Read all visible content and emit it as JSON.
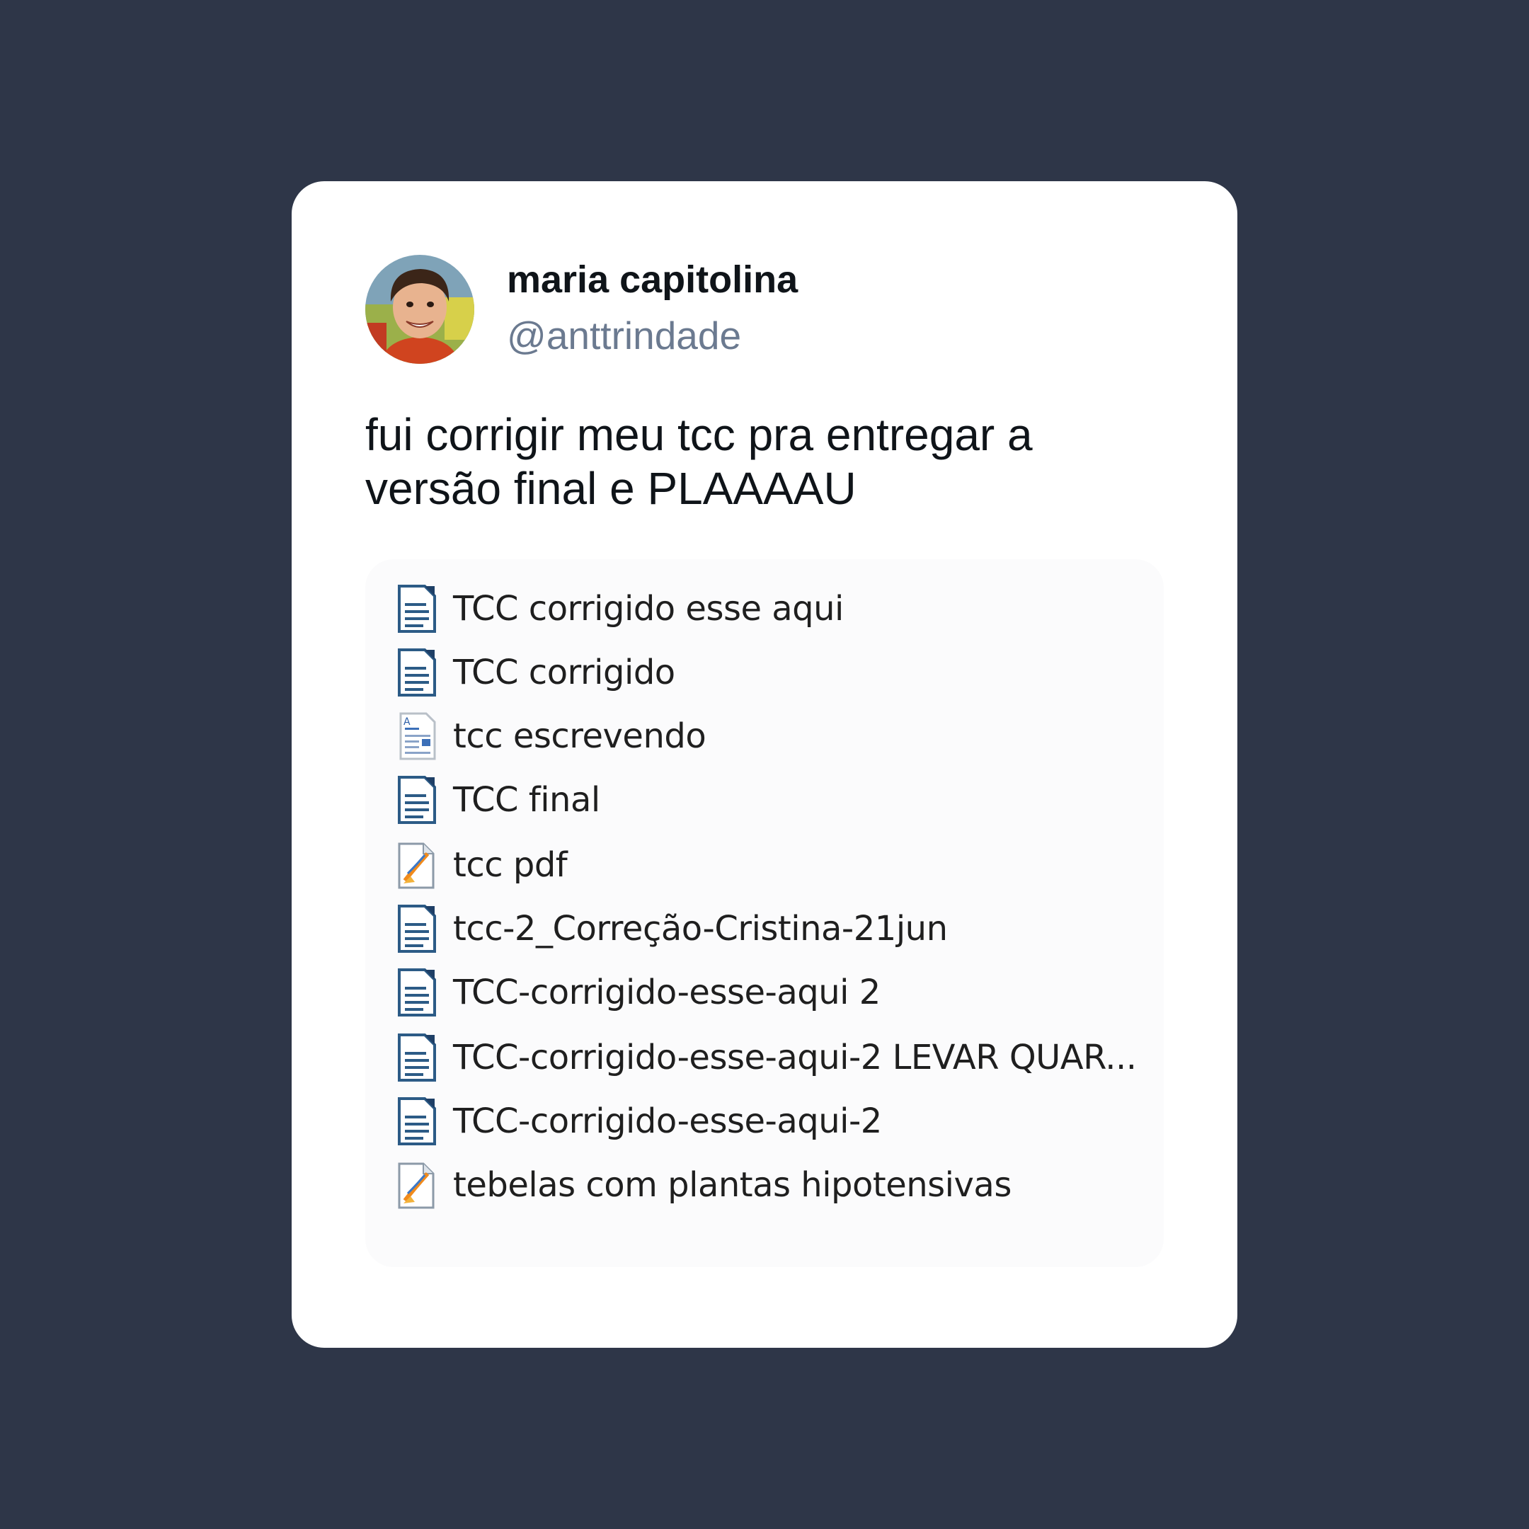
{
  "tweet": {
    "author_name": "maria capitolina",
    "author_handle": "@anttrindade",
    "text": "fui corrigir meu tcc pra entregar a versão final e PLAAAAU",
    "avatar_icon": "profile-photo"
  },
  "attachment": {
    "files": [
      {
        "name": "TCC corrigido esse aqui",
        "icon": "writer-document-icon"
      },
      {
        "name": "TCC corrigido",
        "icon": "writer-document-icon"
      },
      {
        "name": "tcc escrevendo",
        "icon": "word-document-icon"
      },
      {
        "name": "TCC final",
        "icon": "writer-document-icon"
      },
      {
        "name": "tcc pdf",
        "icon": "pdf-document-icon"
      },
      {
        "name": "tcc-2_Correção-Cristina-21jun",
        "icon": "writer-document-icon"
      },
      {
        "name": "TCC-corrigido-esse-aqui 2",
        "icon": "writer-document-icon"
      },
      {
        "name": "TCC-corrigido-esse-aqui-2 LEVAR QUAR...",
        "icon": "writer-document-icon"
      },
      {
        "name": "TCC-corrigido-esse-aqui-2",
        "icon": "writer-document-icon"
      },
      {
        "name": "tebelas com plantas hipotensivas",
        "icon": "pdf-document-icon"
      }
    ]
  },
  "colors": {
    "background": "#2e3648",
    "card": "#ffffff",
    "handle": "#6b7a90",
    "text": "#0f1419"
  }
}
